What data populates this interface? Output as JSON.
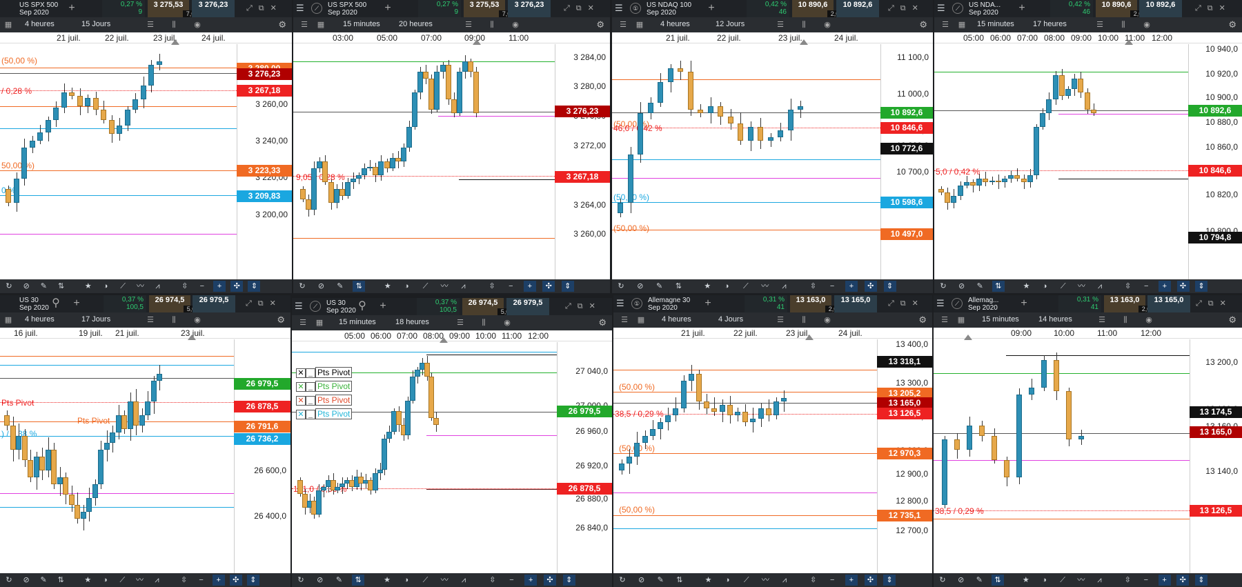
{
  "panels": [
    {
      "name": "US SPX 500",
      "contract": "Sep 2020",
      "chg_pct": "0,27 %",
      "chg_pts": "9",
      "sell": "3 275,53",
      "buy": "3 276,23",
      "spread": "7,0",
      "interval": "4 heures",
      "range": "15 Jours",
      "dates": [
        "21 juil.",
        "22 juil.",
        "23 juil.",
        "24 juil."
      ],
      "yticks": [
        "3 260,00",
        "3 240,00",
        "3 220,00",
        "3 200,00"
      ],
      "labels": [
        "(50,00 %)",
        "/ 0,28 %",
        "50,00 %)",
        "0 %)"
      ],
      "badges": [
        "3 280,00",
        "3 276,23",
        "3 267,18",
        "3 223,33",
        "3 209,83"
      ]
    },
    {
      "name": "US SPX 500",
      "contract": "Sep 2020",
      "chg_pct": "0,27 %",
      "chg_pts": "9",
      "sell": "3 275,53",
      "buy": "3 276,23",
      "spread": "7,0",
      "interval": "15 minutes",
      "range": "20 heures",
      "dates": [
        "03:00",
        "05:00",
        "07:00",
        "09:00",
        "11:00"
      ],
      "yticks": [
        "3 284,00",
        "3 280,00",
        "3 276,00",
        "3 272,00",
        "3 268,00",
        "3 264,00",
        "3 260,00"
      ],
      "labels": [
        "9,05 / 0,28 %"
      ],
      "badges": [
        "3 276,23",
        "3 267,18"
      ]
    },
    {
      "name": "US NDAQ 100",
      "contract": "Sep 2020",
      "chg_pct": "0,42 %",
      "chg_pts": "46",
      "sell": "10 890,6",
      "buy": "10 892,6",
      "spread": "2,0",
      "interval": "4 heures",
      "range": "12 Jours",
      "dates": [
        "21 juil.",
        "22 juil.",
        "23 juil.",
        "24 juil."
      ],
      "yticks": [
        "11 100,0",
        "11 000,0",
        "10 900,0",
        "10 800,0",
        "10 700,0"
      ],
      "labels": [
        "(50,00 %)",
        "46,0 / 0,42 %",
        "(50,00 %)",
        "(50,00 %)"
      ],
      "badges": [
        "10 892,6",
        "10 846,6",
        "10 772,6",
        "10 598,6",
        "10 497,0"
      ]
    },
    {
      "name": "US NDA...",
      "contract": "Sep 2020",
      "chg_pct": "0,42 %",
      "chg_pts": "46",
      "sell": "10 890,6",
      "buy": "10 892,6",
      "spread": "2,0",
      "interval": "15 minutes",
      "range": "17 heures",
      "dates": [
        "05:00",
        "06:00",
        "07:00",
        "08:00",
        "09:00",
        "10:00",
        "11:00",
        "12:00"
      ],
      "yticks": [
        "10 940,0",
        "10 920,0",
        "10 900,0",
        "10 880,0",
        "10 860,0",
        "10 840,0",
        "10 820,0",
        "10 800,0"
      ],
      "labels": [
        "5,0 / 0,42 %"
      ],
      "badges": [
        "10 892,6",
        "10 846,6",
        "10 794,8"
      ]
    },
    {
      "name": "US 30",
      "contract": "Sep 2020",
      "chg_pct": "0,37 %",
      "chg_pts": "100,5",
      "sell": "26 974,5",
      "buy": "26 979,5",
      "spread": "5,0",
      "interval": "4 heures",
      "range": "17 Jours",
      "dates": [
        "16 juil.",
        "19 juil.",
        "21 juil.",
        "23 juil."
      ],
      "yticks": [
        "26 600,0",
        "26 400,0"
      ],
      "labels": [
        "Pts Pivot",
        "Pts Pivot",
        ") / 0,38 %",
        "(50,00 %)",
        "00 %)"
      ],
      "badges": [
        "26 979,5",
        "26 878,5",
        "26 791,6",
        "26 736,2"
      ]
    },
    {
      "name": "US 30",
      "contract": "Sep 2020",
      "chg_pct": "0,37 %",
      "chg_pts": "100,5",
      "sell": "26 974,5",
      "buy": "26 979,5",
      "spread": "5,0",
      "interval": "15 minutes",
      "range": "18 heures",
      "dates": [
        "05:00",
        "06:00",
        "07:00",
        "08:00",
        "09:00",
        "10:00",
        "11:00",
        "12:00"
      ],
      "yticks": [
        "27 040,0",
        "27 000,0",
        "26 960,0",
        "26 920,0",
        "26 880,0",
        "26 840,0"
      ],
      "labels": [
        "101,0 / 0,38 %"
      ],
      "legend": [
        "Pts Pivot",
        "Pts Pivot",
        "Pts Pivot",
        "Pts Pivot"
      ],
      "badges": [
        "26 979,5",
        "26 878,5"
      ]
    },
    {
      "name": "Allemagne 30",
      "contract": "Sep 2020",
      "chg_pct": "0,31 %",
      "chg_pts": "41",
      "sell": "13 163,0",
      "buy": "13 165,0",
      "spread": "2,0",
      "interval": "4 heures",
      "range": "4 Jours",
      "dates": [
        "21 juil.",
        "22 juil.",
        "23 juil.",
        "24 juil."
      ],
      "yticks": [
        "13 400,0",
        "13 300,0",
        "13 200,0",
        "13 100,0",
        "13 000,0",
        "12 900,0",
        "12 800,0",
        "12 700,0"
      ],
      "labels": [
        "(50,00 %)",
        "38,5 / 0,29 %",
        "(50,00 %)",
        "(50,00 %)"
      ],
      "badges": [
        "13 318,1",
        "13 205,2",
        "13 165,0",
        "13 126,5",
        "12 970,3",
        "12 735,1"
      ]
    },
    {
      "name": "Allemag...",
      "contract": "Sep 2020",
      "chg_pct": "0,31 %",
      "chg_pts": "41",
      "sell": "13 163,0",
      "buy": "13 165,0",
      "spread": "2,0",
      "interval": "15 minutes",
      "range": "14 heures",
      "dates": [
        "09:00",
        "10:00",
        "11:00",
        "12:00"
      ],
      "yticks": [
        "13 200,0",
        "13 180,0",
        "13 160,0",
        "13 140,0",
        "13 120,0"
      ],
      "labels": [
        "38,5 / 0,29 %"
      ],
      "badges": [
        "13 174,5",
        "13 165,0",
        "13 126,5"
      ]
    }
  ],
  "colors": {
    "up": "#2d8fb5",
    "down": "#e6a84a",
    "green": "#22b02b",
    "red": "#ee2222",
    "darkred": "#b00000",
    "orange": "#f06a23",
    "blue": "#1aa7e0",
    "black": "#111111"
  }
}
